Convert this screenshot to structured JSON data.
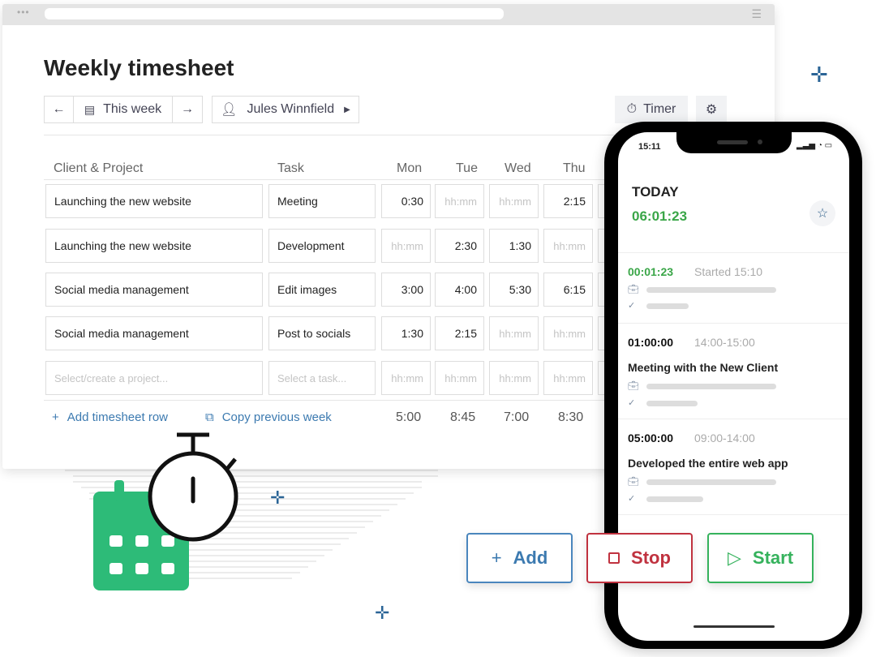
{
  "page": {
    "title": "Weekly timesheet"
  },
  "toolbar": {
    "this_week": "This week",
    "user": "Jules Winnfield",
    "timer": "Timer"
  },
  "table": {
    "headers": [
      "Client & Project",
      "Task",
      "Mon",
      "Tue",
      "Wed",
      "Thu"
    ],
    "rows": [
      {
        "project": "Launching the new website",
        "task": "Meeting",
        "days": [
          "0:30",
          "hh:mm",
          "hh:mm",
          "2:15"
        ]
      },
      {
        "project": "Launching the new website",
        "task": "Development",
        "days": [
          "hh:mm",
          "2:30",
          "1:30",
          "hh:mm"
        ]
      },
      {
        "project": "Social media management",
        "task": "Edit images",
        "days": [
          "3:00",
          "4:00",
          "5:30",
          "6:15"
        ]
      },
      {
        "project": "Social media management",
        "task": "Post to socials",
        "days": [
          "1:30",
          "2:15",
          "hh:mm",
          "hh:mm"
        ]
      }
    ],
    "new_row": {
      "project_placeholder": "Select/create a project...",
      "task_placeholder": "Select a task...",
      "day_placeholder": "hh:mm"
    },
    "add_row": "Add timesheet row",
    "copy_week": "Copy previous week",
    "totals": [
      "5:00",
      "8:45",
      "7:00",
      "8:30"
    ]
  },
  "phone": {
    "clock": "15:11",
    "today_label": "TODAY",
    "today_total": "06:01:23",
    "entries": [
      {
        "duration": "00:01:23",
        "time": "Started 15:10",
        "description": ""
      },
      {
        "duration": "01:00:00",
        "time": "14:00-15:00",
        "description": "Meeting with the New Client"
      },
      {
        "duration": "05:00:00",
        "time": "09:00-14:00",
        "description": "Developed the entire web app"
      }
    ]
  },
  "actions": {
    "add": "Add",
    "stop": "Stop",
    "start": "Start"
  },
  "colors": {
    "green": "#3aa648",
    "blue": "#2f6fa8",
    "red": "#c0323f",
    "calendar": "#2dbb78"
  }
}
